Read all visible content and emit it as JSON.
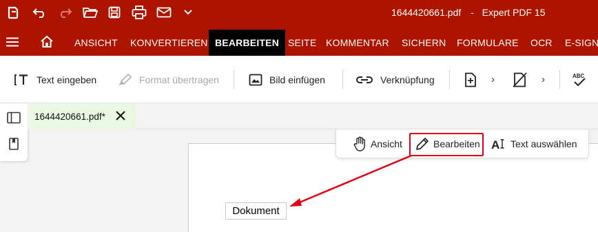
{
  "window": {
    "filename": "1644420661.pdf",
    "separator": "-",
    "app_name": "Expert PDF 15"
  },
  "quick_access": [
    "app-logo-icon",
    "undo-icon",
    "redo-icon",
    "open-folder-icon",
    "save-icon",
    "print-icon",
    "email-icon",
    "chevron-down-icon"
  ],
  "tabs": {
    "ansicht": "ANSICHT",
    "konvertieren": "KONVERTIEREN",
    "bearbeiten": "BEARBEITEN",
    "seite": "SEITE",
    "kommentar": "KOMMENTAR",
    "sichern": "SICHERN",
    "formulare": "FORMULARE",
    "ocr": "OCR",
    "esign": "E-SIGN"
  },
  "ribbon": {
    "text_eingeben": "Text eingeben",
    "format_uebertragen": "Format übertragen",
    "bild_einfuegen": "Bild einfügen",
    "verknuepfung": "Verknüpfung",
    "chevron": "›"
  },
  "doc_tab": {
    "label": "1644420661.pdf*"
  },
  "mode_toolbar": {
    "ansicht": "Ansicht",
    "bearbeiten": "Bearbeiten",
    "text_auswaehlen": "Text auswählen"
  },
  "document": {
    "text": "Dokument"
  },
  "colors": {
    "brand_red": "#ad1400",
    "active_tab": "#000000",
    "highlight": "#e0000f",
    "doc_tab_bg": "#eaf7e3"
  }
}
